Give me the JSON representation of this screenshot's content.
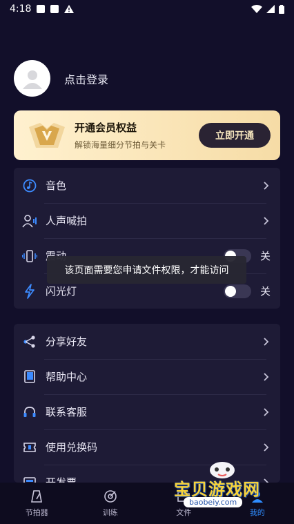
{
  "status_bar": {
    "time": "4:18"
  },
  "profile": {
    "login_label": "点击登录"
  },
  "vip": {
    "title": "开通会员权益",
    "subtitle": "解锁海量细分节拍与关卡",
    "button": "立即开通",
    "accent": "#f6dca6"
  },
  "settings": [
    {
      "label": "音色",
      "icon": "music-note-icon",
      "type": "nav"
    },
    {
      "label": "人声喊拍",
      "icon": "voice-user-icon",
      "type": "nav"
    },
    {
      "label": "震动",
      "icon": "vibrate-icon",
      "type": "toggle",
      "state": "关"
    },
    {
      "label": "闪光灯",
      "icon": "flash-icon",
      "type": "toggle",
      "state": "关"
    }
  ],
  "more": [
    {
      "label": "分享好友",
      "icon": "share-icon"
    },
    {
      "label": "帮助中心",
      "icon": "book-icon"
    },
    {
      "label": "联系客服",
      "icon": "headset-icon"
    },
    {
      "label": "使用兑换码",
      "icon": "ticket-icon"
    },
    {
      "label": "开发票",
      "icon": "invoice-icon"
    }
  ],
  "toast": "该页面需要您申请文件权限，才能访问",
  "tabs": [
    {
      "label": "节拍器",
      "icon": "metronome-icon"
    },
    {
      "label": "训练",
      "icon": "target-icon"
    },
    {
      "label": "文件",
      "icon": "folder-icon"
    },
    {
      "label": "我的",
      "icon": "user-icon",
      "active": true
    }
  ],
  "watermark": {
    "title": "宝贝游戏网",
    "url": "baobeiy.com"
  }
}
